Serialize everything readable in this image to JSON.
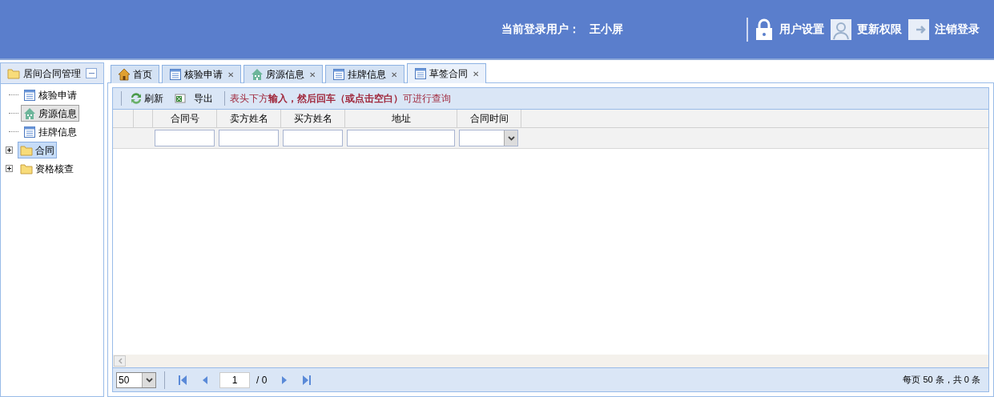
{
  "header": {
    "user_label": "当前登录用户：",
    "user_name": "王小屏",
    "actions": [
      {
        "kind": "lock",
        "label": "用户设置"
      },
      {
        "kind": "person",
        "label": "更新权限"
      },
      {
        "kind": "logout",
        "label": "注销登录"
      }
    ]
  },
  "sidebar": {
    "title": "居间合同管理",
    "items": [
      {
        "label": "核验申请",
        "kind": "doc",
        "selected": false,
        "hovered": false
      },
      {
        "label": "房源信息",
        "kind": "house",
        "selected": false,
        "hovered": true
      },
      {
        "label": "挂牌信息",
        "kind": "doc",
        "selected": false,
        "hovered": false
      },
      {
        "label": "合同",
        "kind": "folder",
        "selected": true,
        "hovered": false
      },
      {
        "label": "资格核查",
        "kind": "folder",
        "selected": false,
        "hovered": false
      }
    ]
  },
  "tabs": [
    {
      "label": "首页",
      "kind": "home",
      "closable": false,
      "selected": false
    },
    {
      "label": "核验申请",
      "kind": "doc",
      "closable": true,
      "selected": false
    },
    {
      "label": "房源信息",
      "kind": "house",
      "closable": true,
      "selected": false
    },
    {
      "label": "挂牌信息",
      "kind": "doc",
      "closable": true,
      "selected": false
    },
    {
      "label": "草签合同",
      "kind": "doc",
      "closable": true,
      "selected": true
    }
  ],
  "close_mark": "✕",
  "toolbar": {
    "buttons": [
      {
        "kind": "refresh",
        "label": "刷新"
      },
      {
        "kind": "export",
        "label": "导出"
      }
    ],
    "hint": "表头下方**输入，然后回车（或点击空白）**可进行查询"
  },
  "table": {
    "columns": [
      {
        "label": "合同号",
        "kind": "text"
      },
      {
        "label": "卖方姓名",
        "kind": "text"
      },
      {
        "label": "买方姓名",
        "kind": "text"
      },
      {
        "label": "地址",
        "kind": "text"
      },
      {
        "label": "合同时间",
        "kind": "select"
      }
    ]
  },
  "pager": {
    "page_size": "50",
    "page": "1",
    "total_pages": "/ 0",
    "info": "每页 50 条，共 0 条"
  }
}
